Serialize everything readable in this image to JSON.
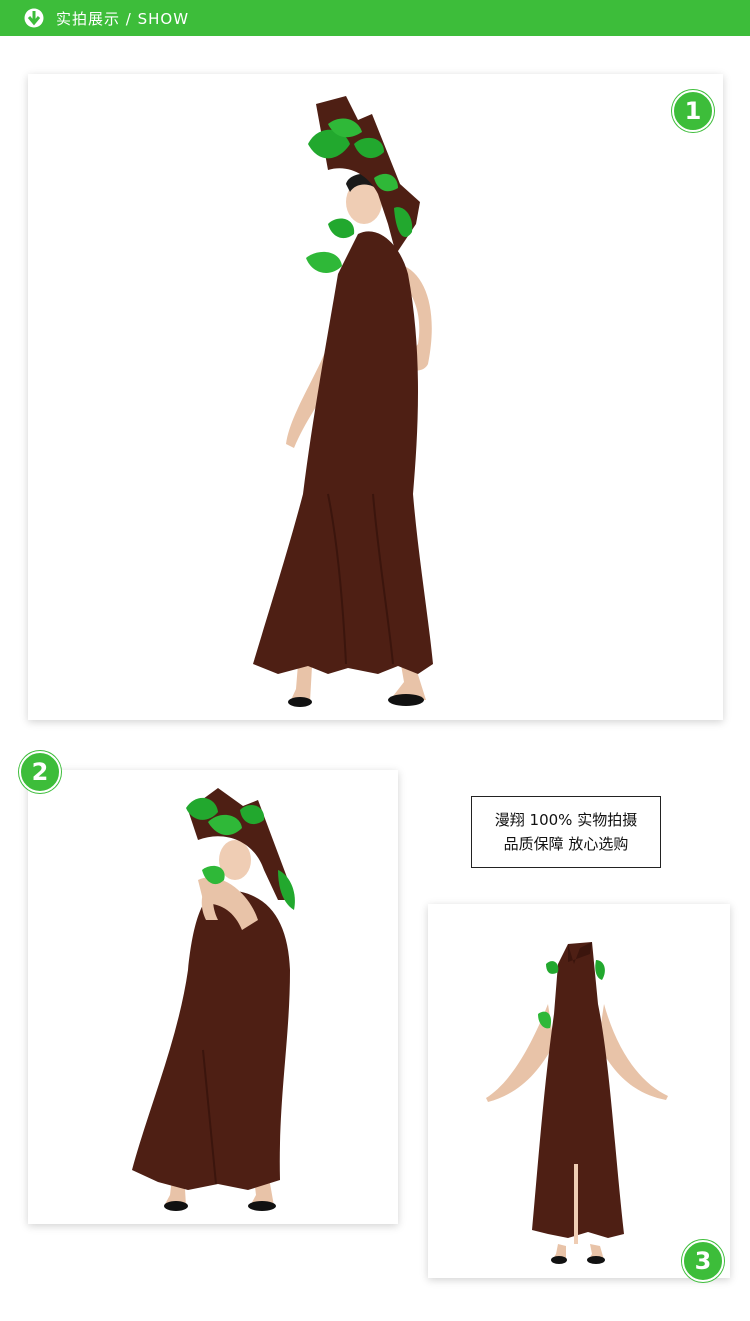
{
  "header": {
    "title": "实拍展示 / SHOW",
    "background_color": "#3dbd3a",
    "icon": "down-arrow-circle-icon"
  },
  "photos": [
    {
      "badge": "1",
      "description_icon": "tree-costume-front-pose"
    },
    {
      "badge": "2",
      "description_icon": "tree-costume-side-pose"
    },
    {
      "badge": "3",
      "description_icon": "tree-costume-back-pose"
    }
  ],
  "notice": {
    "line1": "漫翔 100% 实物拍摄",
    "line2": "品质保障 放心选购"
  },
  "colors": {
    "accent": "#3dbd3a",
    "costume_brown": "#4e1f14",
    "leaf_green": "#22a82e"
  }
}
